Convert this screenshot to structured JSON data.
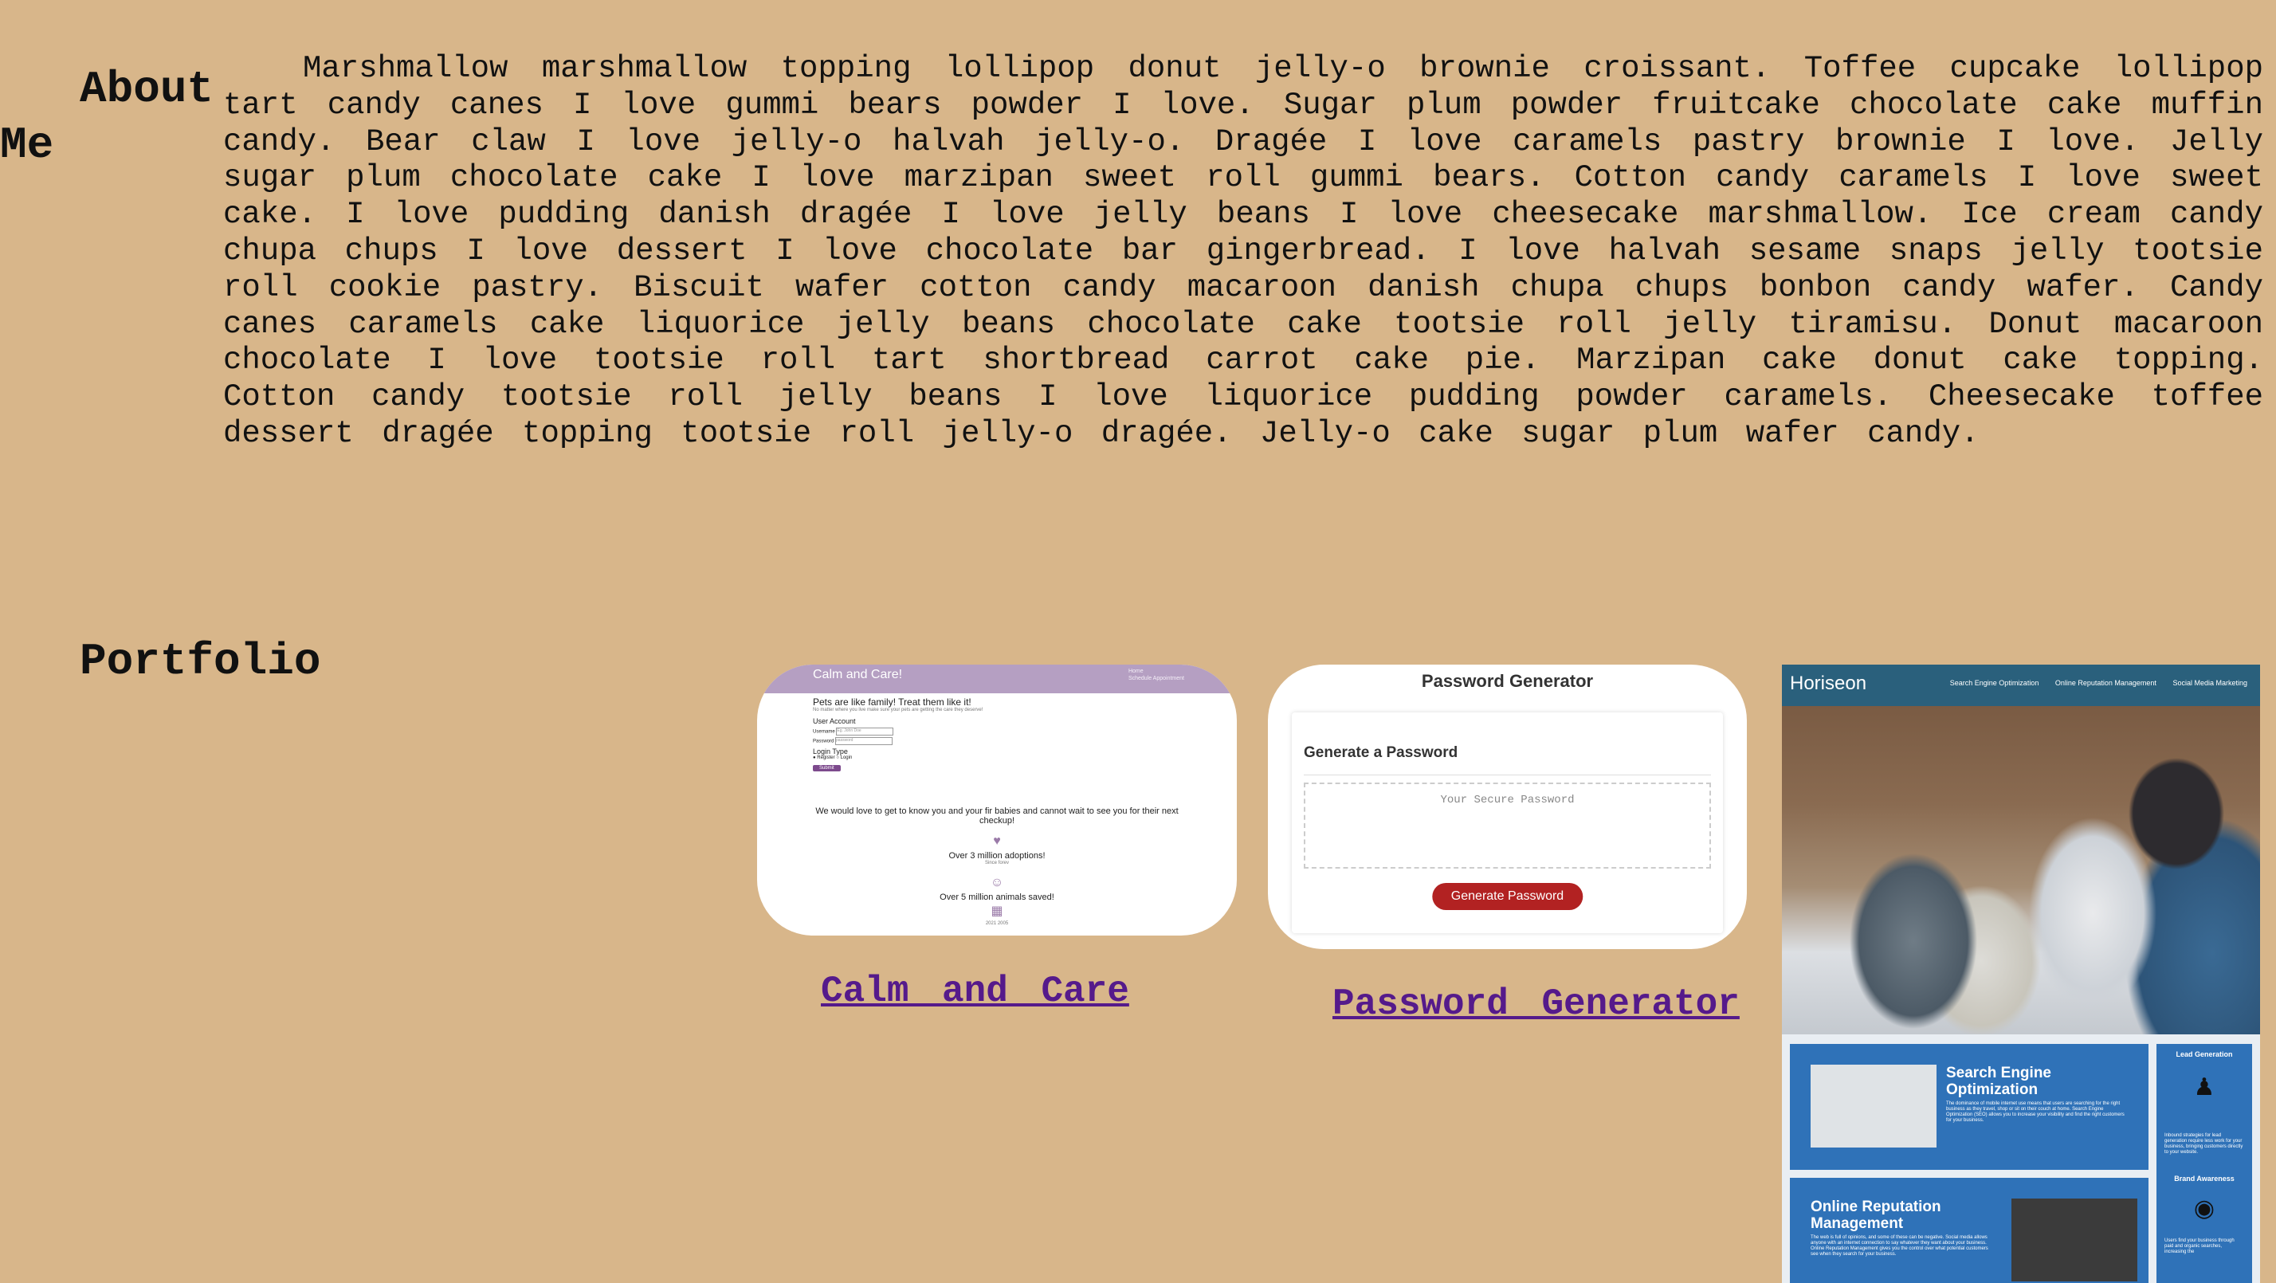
{
  "about": {
    "heading_line1": "About",
    "heading_line2": "Me",
    "bio": "Marshmallow marshmallow topping lollipop donut jelly-o brownie croissant. Toffee cupcake lollipop tart candy canes I love gummi bears powder I love. Sugar plum powder fruitcake chocolate cake muffin candy. Bear claw I love jelly-o halvah jelly-o. Dragée I love caramels pastry brownie I love. Jelly sugar plum chocolate cake I love marzipan sweet roll gummi bears. Cotton candy caramels I love sweet cake. I love pudding danish dragée I love jelly beans I love cheesecake marshmallow. Ice cream candy chupa chups I love dessert I love chocolate bar gingerbread. I love halvah sesame snaps jelly tootsie roll cookie pastry. Biscuit wafer cotton candy macaroon danish chupa chups bonbon candy wafer. Candy canes caramels cake liquorice jelly beans chocolate cake tootsie roll jelly tiramisu. Donut macaroon chocolate I love tootsie roll tart shortbread carrot cake pie. Marzipan cake donut cake topping. Cotton candy tootsie roll jelly beans I love liquorice pudding powder caramels. Cheesecake toffee dessert dragée topping tootsie roll jelly-o dragée. Jelly-o cake sugar plum wafer candy."
  },
  "portfolio": {
    "heading": "Portfolio",
    "projects": [
      {
        "link": "Calm and Care",
        "thumb": {
          "brand": "Calm and Care!",
          "nav1": "Home",
          "nav2": "Schedule Appointment",
          "headline": "Pets are like family! Treat them like it!",
          "sub": "No matter where you live make sure your pets are getting the care they deserve!",
          "account": "User Account",
          "username_label": "Username",
          "username_ph": "Eg. John Doe",
          "password_label": "Password",
          "password_ph": "password",
          "login_type": "Login Type",
          "register": "Register",
          "login": "Login",
          "submit": "Submit",
          "message": "We would love to get to know you and your fir babies and cannot wait to see you for their next checkup!",
          "stat1": "Over 3 million adoptions!",
          "stat1_sub": "Since forev",
          "stat2": "Over 5 million animals saved!",
          "stat2_sub": "2021 2005"
        }
      },
      {
        "link": "Password Generator",
        "thumb": {
          "title": "Password Generator",
          "subtitle": "Generate a Password",
          "placeholder": "Your Secure Password",
          "button": "Generate Password"
        }
      },
      {
        "thumb": {
          "logo": "Horiseon",
          "nav": [
            "Search Engine Optimization",
            "Online Reputation Management",
            "Social Media Marketing"
          ],
          "box1_title": "Search Engine Optimization",
          "box1_text": "The dominance of mobile internet use means that users are searching for the right business as they travel, shop or sit on their couch at home. Search Engine Optimization (SEO) allows you to increase your visibility and find the right customers for your business.",
          "box2_title": "Online Reputation Management",
          "box2_text": "The web is full of opinions, and some of these can be negative. Social media allows anyone with an internet connection to say whatever they want about your business. Online Reputation Management gives you the control over what potential customers see when they search for your business.",
          "side1_title": "Lead Generation",
          "side1_text": "Inbound strategies for lead generation require less work for your business, bringing customers directly to your website.",
          "side2_title": "Brand Awareness",
          "side2_text": "Users find your business through paid and organic searches, increasing the"
        }
      }
    ]
  }
}
